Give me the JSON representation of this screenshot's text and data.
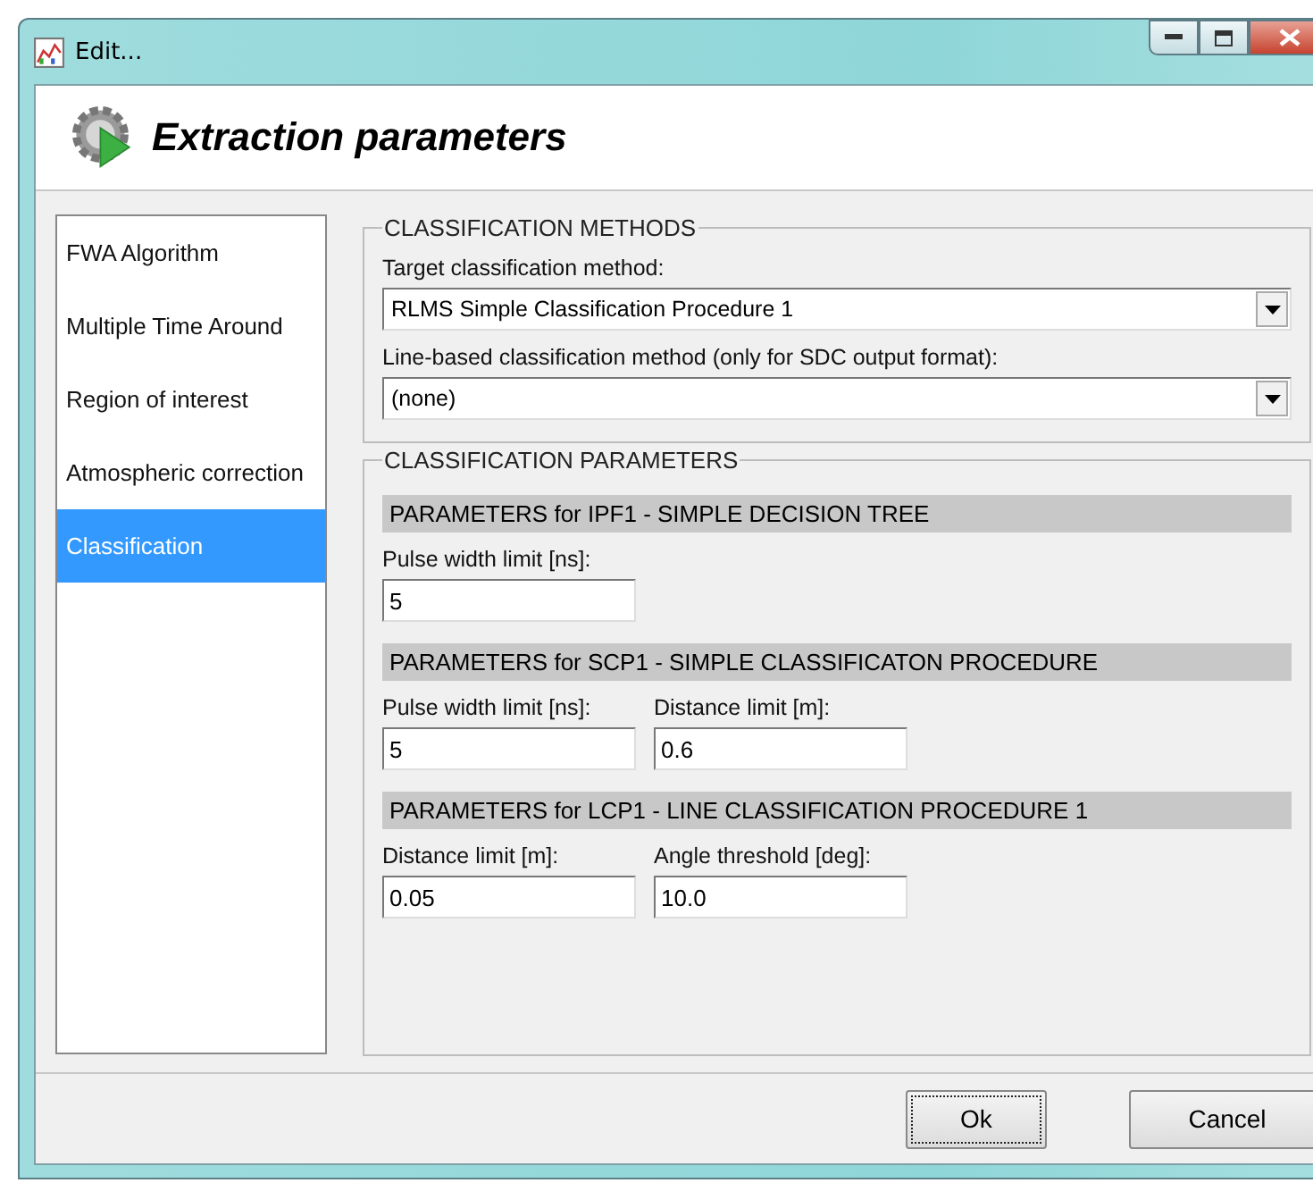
{
  "window": {
    "title": "Edit..."
  },
  "header": {
    "title": "Extraction parameters"
  },
  "sidebar": {
    "items": [
      {
        "label": "FWA Algorithm",
        "selected": false
      },
      {
        "label": "Multiple Time Around",
        "selected": false
      },
      {
        "label": "Region of interest",
        "selected": false
      },
      {
        "label": "Atmospheric correction",
        "selected": false
      },
      {
        "label": "Classification",
        "selected": true
      }
    ]
  },
  "classification_methods": {
    "title": "CLASSIFICATION METHODS",
    "fields": [
      {
        "label": "Target classification method:",
        "value": "RLMS Simple Classification Procedure 1"
      },
      {
        "label": "Line-based classification method (only for SDC output format):",
        "value": "(none)"
      }
    ]
  },
  "classification_parameters": {
    "title": "CLASSIFICATION PARAMETERS",
    "sections": [
      {
        "title": "PARAMETERS for IPF1 - SIMPLE DECISION TREE",
        "fields": [
          {
            "label": "Pulse width limit [ns]:",
            "value": "5"
          }
        ]
      },
      {
        "title": "PARAMETERS for SCP1 - SIMPLE CLASSIFICATON PROCEDURE",
        "fields": [
          {
            "label": "Pulse width limit [ns]:",
            "value": "5"
          },
          {
            "label": "Distance limit [m]:",
            "value": "0.6"
          }
        ]
      },
      {
        "title": "PARAMETERS for LCP1 - LINE CLASSIFICATION PROCEDURE 1",
        "fields": [
          {
            "label": "Distance limit [m]:",
            "value": "0.05"
          },
          {
            "label": "Angle threshold [deg]:",
            "value": "10.0"
          }
        ]
      }
    ]
  },
  "buttons": [
    {
      "label": "Ok",
      "focused": true
    },
    {
      "label": "Cancel",
      "focused": false
    }
  ]
}
